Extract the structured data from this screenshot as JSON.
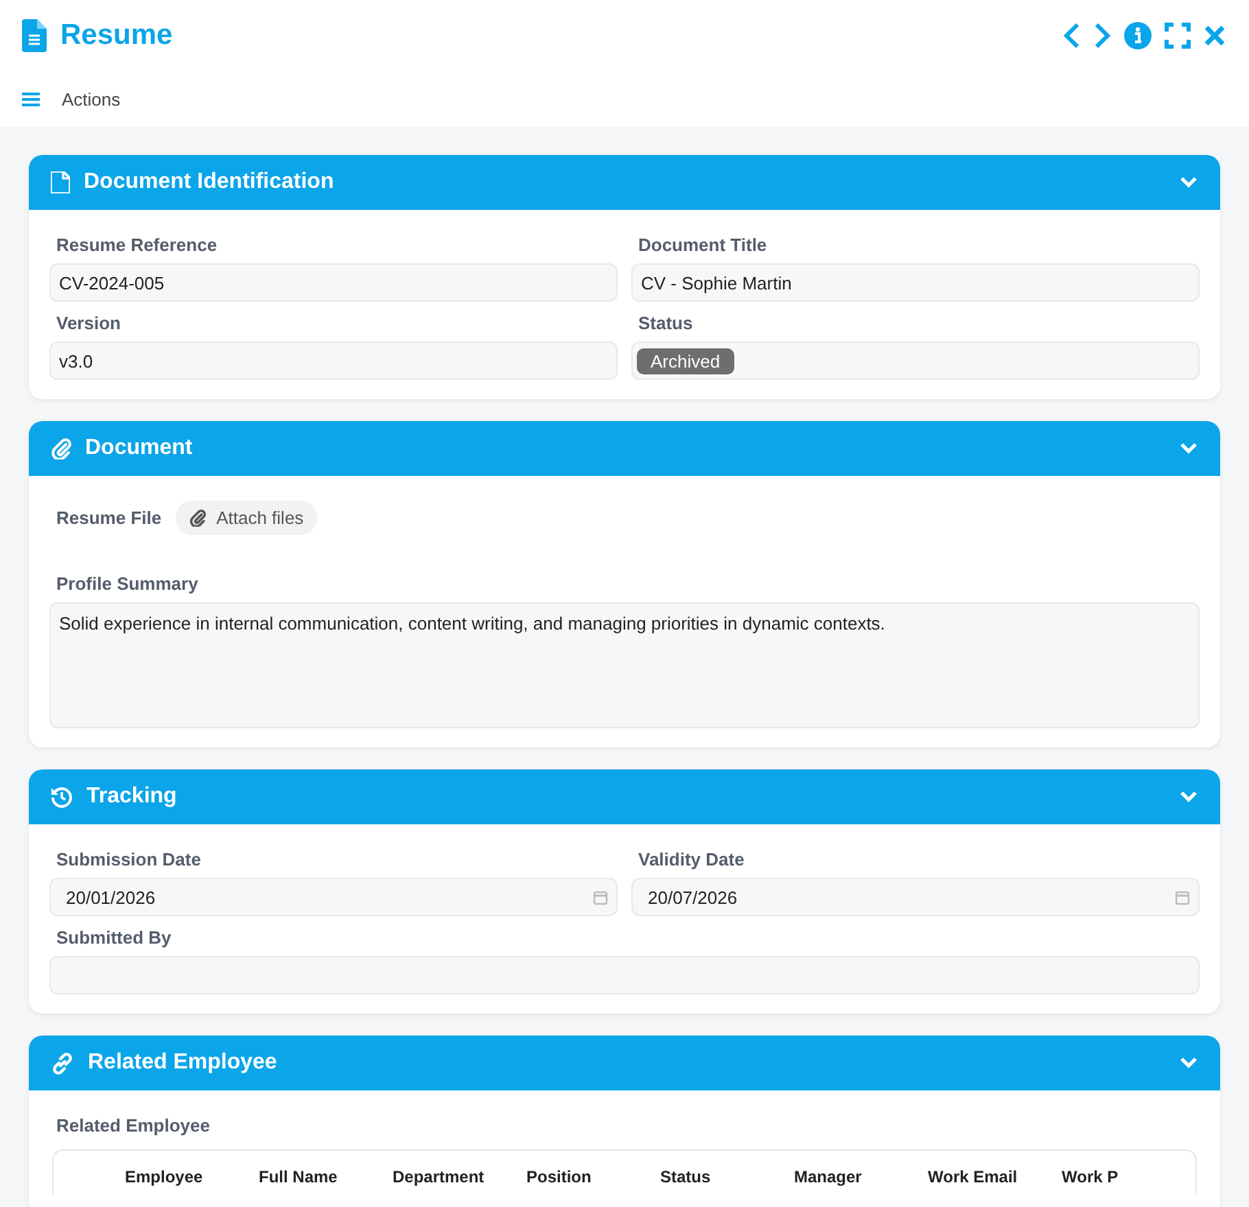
{
  "window": {
    "title": "Resume"
  },
  "toolbar": {
    "label": "Actions"
  },
  "sections": [
    {
      "kind": "identification",
      "title": "Document Identification",
      "expanded": true,
      "fields": [
        {
          "kind": "text",
          "label": "Resume Reference",
          "value": "CV-2024-005"
        },
        {
          "kind": "text",
          "label": "Document Title",
          "value": "CV - Sophie Martin"
        },
        {
          "kind": "text",
          "label": "Version",
          "value": "v3.0"
        },
        {
          "kind": "badge",
          "label": "Status",
          "value": "Archived"
        }
      ]
    },
    {
      "kind": "document",
      "title": "Document",
      "expanded": true,
      "fields": [
        {
          "kind": "file",
          "label": "Resume File",
          "value": "Attach files"
        },
        {
          "kind": "textarea",
          "label": "Profile Summary",
          "value": "Solid experience in internal communication, content writing, and managing priorities in dynamic contexts."
        }
      ]
    },
    {
      "kind": "tracking",
      "title": "Tracking",
      "expanded": true,
      "fields": [
        {
          "kind": "date",
          "label": "Submission Date",
          "value": "20/01/2026"
        },
        {
          "kind": "date",
          "label": "Validity Date",
          "value": "20/07/2026"
        },
        {
          "kind": "wide",
          "label": "Submitted By"
        }
      ]
    },
    {
      "kind": "related",
      "title": "Related Employee",
      "expanded": true,
      "fields": [
        {
          "kind": "table",
          "label": "Related Employee",
          "columns": [
            "Employee",
            "Full Name",
            "Department",
            "Position",
            "Status",
            "Manager",
            "Work Email",
            "Work P"
          ]
        }
      ]
    }
  ]
}
